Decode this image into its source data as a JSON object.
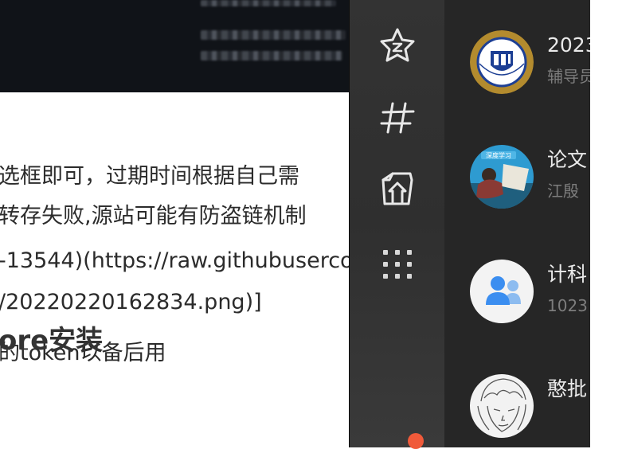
{
  "document": {
    "lines": [
      "选框即可，过期时间根据自己需",
      "转存失败,源站可能有防盗链机制",
      "-13544)(https://raw.githubuserco",
      "/20220220162834.png)]",
      "的token以备后用"
    ],
    "heading": "ore安装"
  },
  "rail": {
    "icons": [
      "favorites-star-icon",
      "topic-hash-icon",
      "files-icon",
      "more-apps-grid-icon"
    ]
  },
  "chats": [
    {
      "name": "2023",
      "sub": "辅导员"
    },
    {
      "name": "论文",
      "sub": "江殷"
    },
    {
      "name": "计科",
      "sub": "1023"
    },
    {
      "name": "憨批",
      "sub": ""
    }
  ],
  "colors": {
    "header_bg": "#101318",
    "app_bg": "#202020",
    "rail_bg": "#333333",
    "notification": "#f05a3a",
    "group_avatar_blue": "#3b8ef0"
  }
}
